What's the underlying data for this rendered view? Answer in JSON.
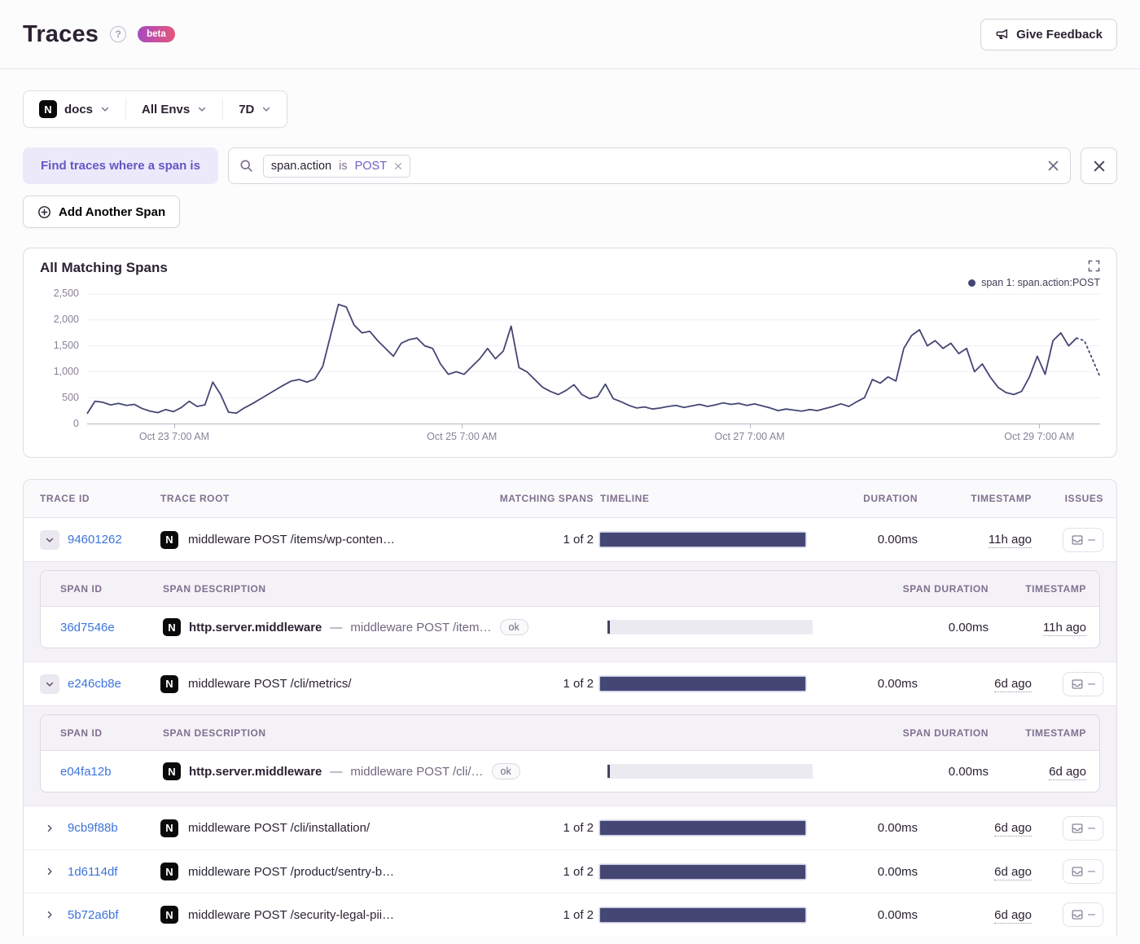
{
  "header": {
    "title": "Traces",
    "beta_label": "beta",
    "feedback_label": "Give Feedback"
  },
  "filters": {
    "project": "docs",
    "environment": "All Envs",
    "period": "7D"
  },
  "span_query": {
    "label": "Find traces where a span is",
    "token": {
      "key": "span.action",
      "op": "is",
      "value": "POST"
    },
    "add_button": "Add Another Span"
  },
  "chart": {
    "title": "All Matching Spans",
    "legend": "span 1: span.action:POST"
  },
  "chart_data": {
    "type": "line",
    "title": "All Matching Spans",
    "series_name": "span 1: span.action:POST",
    "ylim": [
      0,
      2500
    ],
    "y_ticks": [
      {
        "label": "0",
        "value": 0
      },
      {
        "label": "500",
        "value": 500
      },
      {
        "label": "1,000",
        "value": 1000
      },
      {
        "label": "1,500",
        "value": 1500
      },
      {
        "label": "2,000",
        "value": 2000
      },
      {
        "label": "2,500",
        "value": 2500
      }
    ],
    "x_ticks": [
      {
        "label": "Oct 23 7:00 AM",
        "frac": 0.086
      },
      {
        "label": "Oct 25 7:00 AM",
        "frac": 0.37
      },
      {
        "label": "Oct 27 7:00 AM",
        "frac": 0.654
      },
      {
        "label": "Oct 29 7:00 AM",
        "frac": 0.94
      }
    ],
    "values": [
      190,
      430,
      410,
      360,
      390,
      350,
      370,
      290,
      240,
      210,
      270,
      230,
      310,
      430,
      330,
      360,
      800,
      560,
      220,
      200,
      300,
      380,
      470,
      560,
      650,
      740,
      820,
      850,
      800,
      860,
      1100,
      1700,
      2300,
      2250,
      1900,
      1750,
      1780,
      1600,
      1450,
      1300,
      1550,
      1620,
      1650,
      1500,
      1450,
      1150,
      950,
      1000,
      950,
      1100,
      1250,
      1450,
      1250,
      1400,
      1880,
      1080,
      1000,
      850,
      700,
      620,
      560,
      640,
      750,
      560,
      480,
      520,
      760,
      480,
      420,
      350,
      300,
      320,
      280,
      300,
      330,
      350,
      310,
      340,
      370,
      330,
      360,
      400,
      370,
      390,
      350,
      380,
      340,
      300,
      250,
      280,
      260,
      240,
      270,
      250,
      290,
      330,
      380,
      330,
      420,
      500,
      850,
      780,
      900,
      820,
      1450,
      1700,
      1810,
      1500,
      1600,
      1450,
      1550,
      1350,
      1450,
      1000,
      1150,
      900,
      700,
      600,
      560,
      620,
      900,
      1300,
      950,
      1600,
      1750,
      1500,
      1650,
      1600,
      1250,
      900
    ],
    "dashed_tail_points": 4,
    "grid": true,
    "legend_position": "top-right"
  },
  "table": {
    "columns": [
      "TRACE ID",
      "TRACE ROOT",
      "MATCHING SPANS",
      "TIMELINE",
      "DURATION",
      "TIMESTAMP",
      "ISSUES"
    ],
    "span_columns": [
      "SPAN ID",
      "SPAN DESCRIPTION",
      "SPAN DURATION",
      "TIMESTAMP"
    ],
    "rows": [
      {
        "trace_id": "94601262",
        "root": "middleware POST /items/wp-conten…",
        "matching": "1 of 2",
        "duration": "0.00ms",
        "timestamp": "11h ago",
        "expanded": true,
        "spans": [
          {
            "span_id": "36d7546e",
            "op": "http.server.middleware",
            "desc": "middleware POST /item…",
            "status": "ok",
            "duration": "0.00ms",
            "timestamp": "11h ago"
          }
        ]
      },
      {
        "trace_id": "e246cb8e",
        "root": "middleware POST /cli/metrics/",
        "matching": "1 of 2",
        "duration": "0.00ms",
        "timestamp": "6d ago",
        "expanded": true,
        "spans": [
          {
            "span_id": "e04fa12b",
            "op": "http.server.middleware",
            "desc": "middleware POST /cli/…",
            "status": "ok",
            "duration": "0.00ms",
            "timestamp": "6d ago"
          }
        ]
      },
      {
        "trace_id": "9cb9f88b",
        "root": "middleware POST /cli/installation/",
        "matching": "1 of 2",
        "duration": "0.00ms",
        "timestamp": "6d ago",
        "expanded": false,
        "spans": []
      },
      {
        "trace_id": "1d6114df",
        "root": "middleware POST /product/sentry-b…",
        "matching": "1 of 2",
        "duration": "0.00ms",
        "timestamp": "6d ago",
        "expanded": false,
        "spans": []
      },
      {
        "trace_id": "5b72a6bf",
        "root": "middleware POST /security-legal-pii…",
        "matching": "1 of 2",
        "duration": "0.00ms",
        "timestamp": "6d ago",
        "expanded": false,
        "spans": []
      }
    ]
  },
  "colors": {
    "series": "#444674",
    "timeline_bar": "#444674",
    "accent_purple": "#6c5fc7",
    "link_blue": "#3c74dd",
    "grid_line": "#f0eef4",
    "axis_line": "#b9b2c4"
  }
}
